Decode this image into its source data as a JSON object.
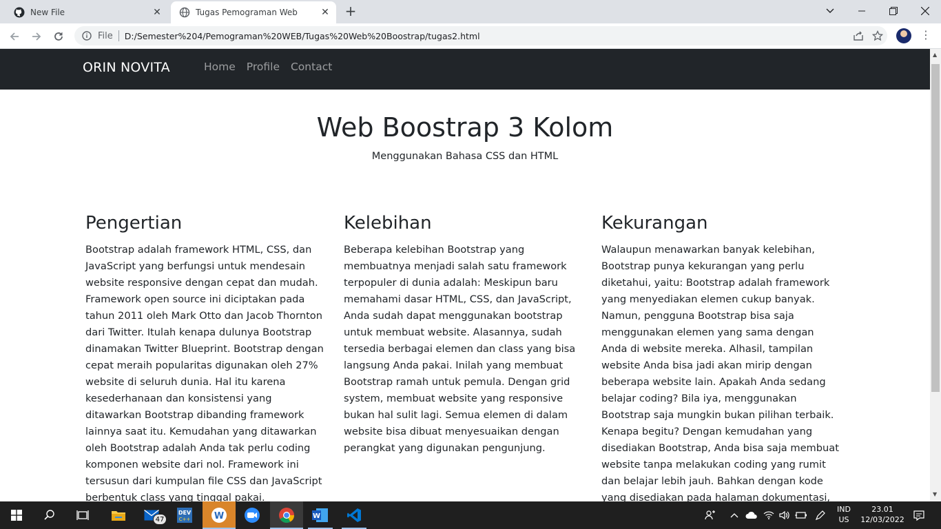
{
  "browser": {
    "tabs": [
      {
        "title": "New File",
        "active": false
      },
      {
        "title": "Tugas Pemograman Web",
        "active": true
      }
    ],
    "address": {
      "scheme_label": "File",
      "url": "D:/Semester%204/Pemograman%20WEB/Tugas%20Web%20Boostrap/tugas2.html"
    }
  },
  "page": {
    "navbar": {
      "brand": "ORIN NOVITA",
      "links": [
        "Home",
        "Profile",
        "Contact"
      ]
    },
    "hero": {
      "title": "Web Boostrap 3 Kolom",
      "subtitle": "Menggunakan Bahasa CSS dan HTML"
    },
    "columns": [
      {
        "heading": "Pengertian",
        "body": "Bootstrap adalah framework HTML, CSS, dan JavaScript yang berfungsi untuk mendesain website responsive dengan cepat dan mudah. Framework open source ini diciptakan pada tahun 2011 oleh Mark Otto dan Jacob Thornton dari Twitter. Itulah kenapa dulunya Bootstrap dinamakan Twitter Blueprint. Bootstrap dengan cepat meraih popularitas digunakan oleh 27% website di seluruh dunia. Hal itu karena kesederhanaan dan konsistensi yang ditawarkan Bootstrap dibanding framework lainnya saat itu. Kemudahan yang ditawarkan oleh Bootstrap adalah Anda tak perlu coding komponen website dari nol. Framework ini tersusun dari kumpulan file CSS dan JavaScript berbentuk class yang tinggal pakai."
      },
      {
        "heading": "Kelebihan",
        "body": "Beberapa kelebihan Bootstrap yang membuatnya menjadi salah satu framework terpopuler di dunia adalah: Meskipun baru memahami dasar HTML, CSS, dan JavaScript, Anda sudah dapat menggunakan bootstrap untuk membuat website. Alasannya, sudah tersedia berbagai elemen dan class yang bisa langsung Anda pakai. Inilah yang membuat Bootstrap ramah untuk pemula. Dengan grid system, membuat website yang responsive bukan hal sulit lagi. Semua elemen di dalam website bisa dibuat menyesuaikan dengan perangkat yang digunakan pengunjung."
      },
      {
        "heading": "Kekurangan",
        "body": "Walaupun menawarkan banyak kelebihan, Bootstrap punya kekurangan yang perlu diketahui, yaitu: Bootstrap adalah framework yang menyediakan elemen cukup banyak. Namun, pengguna Bootstrap bisa saja menggunakan elemen yang sama dengan Anda di website mereka. Alhasil, tampilan website Anda bisa jadi akan mirip dengan beberapa website lain. Apakah Anda sedang belajar coding? Bila iya, menggunakan Bootstrap saja mungkin bukan pilihan terbaik. Kenapa begitu? Dengan kemudahan yang disediakan Bootstrap, Anda bisa saja membuat website tanpa melakukan coding yang rumit dan belajar lebih jauh. Bahkan dengan kode yang disediakan pada halaman dokumentasi, bisa saja membuat Anda"
      }
    ]
  },
  "taskbar": {
    "mail_badge": "47",
    "language_line1": "IND",
    "language_line2": "US",
    "time": "23.01",
    "date": "12/03/2022"
  }
}
